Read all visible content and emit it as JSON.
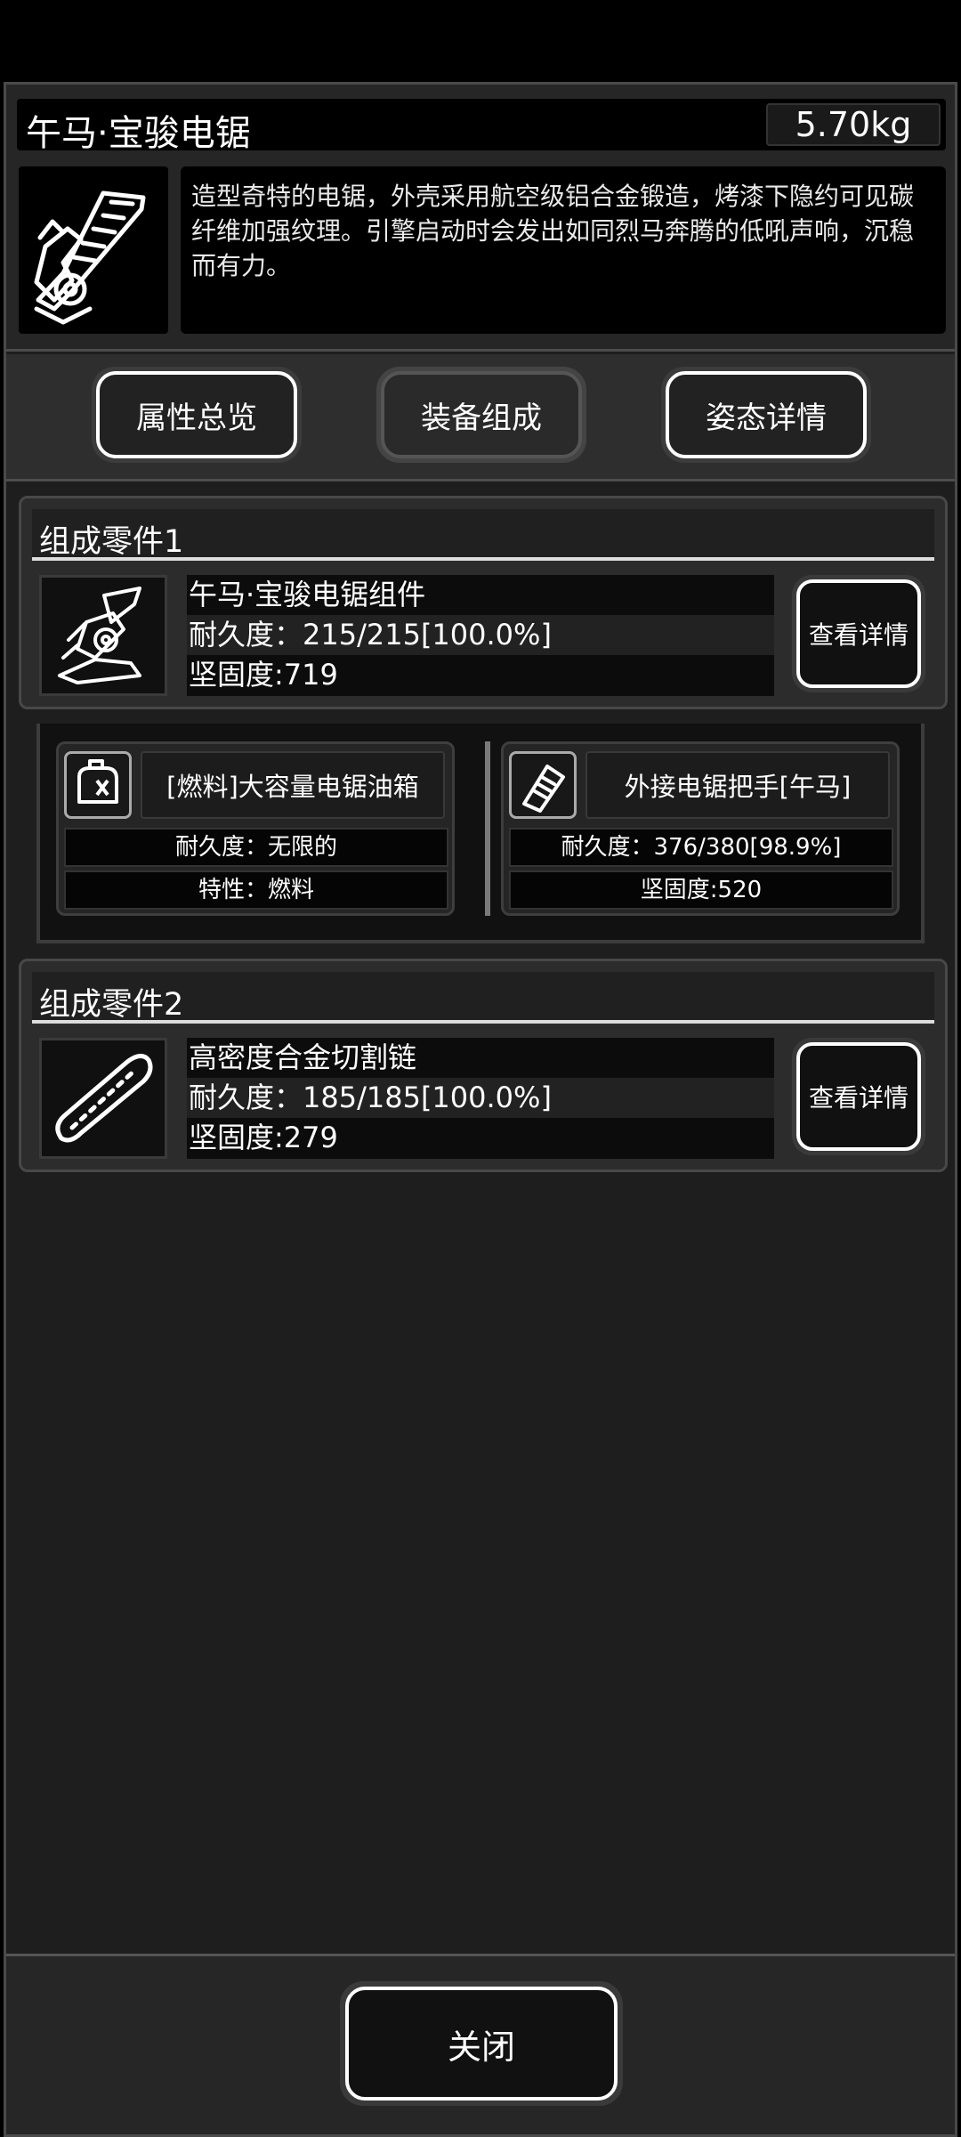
{
  "header": {
    "title": "午马·宝骏电锯",
    "weight": "5.70kg",
    "description": "造型奇特的电锯，外壳采用航空级铝合金锻造，烤漆下隐约可见碳纤维加强纹理。引擎启动时会发出如同烈马奔腾的低吼声响，沉稳而有力。",
    "icon": "chainsaw-horse-icon"
  },
  "tabs": [
    {
      "label": "属性总览"
    },
    {
      "label": "装备组成"
    },
    {
      "label": "姿态详情"
    }
  ],
  "parts": [
    {
      "heading": "组成零件1",
      "name": "午马·宝骏电锯组件",
      "durability": "耐久度：215/215[100.0%]",
      "hardness": "坚固度:719",
      "button": "查看详情",
      "icon": "chainsaw-body-icon",
      "subparts": [
        {
          "name": "[燃料]大容量电锯油箱",
          "line1": "耐久度：无限的",
          "line2": "特性：燃料",
          "icon": "fuel-tank-icon"
        },
        {
          "name": "外接电锯把手[午马]",
          "line1": "耐久度：376/380[98.9%]",
          "line2": "坚固度:520",
          "icon": "handle-icon"
        }
      ]
    },
    {
      "heading": "组成零件2",
      "name": "高密度合金切割链",
      "durability": "耐久度：185/185[100.0%]",
      "hardness": "坚固度:279",
      "button": "查看详情",
      "icon": "saw-chain-icon"
    }
  ],
  "footer": {
    "close_label": "关闭"
  }
}
